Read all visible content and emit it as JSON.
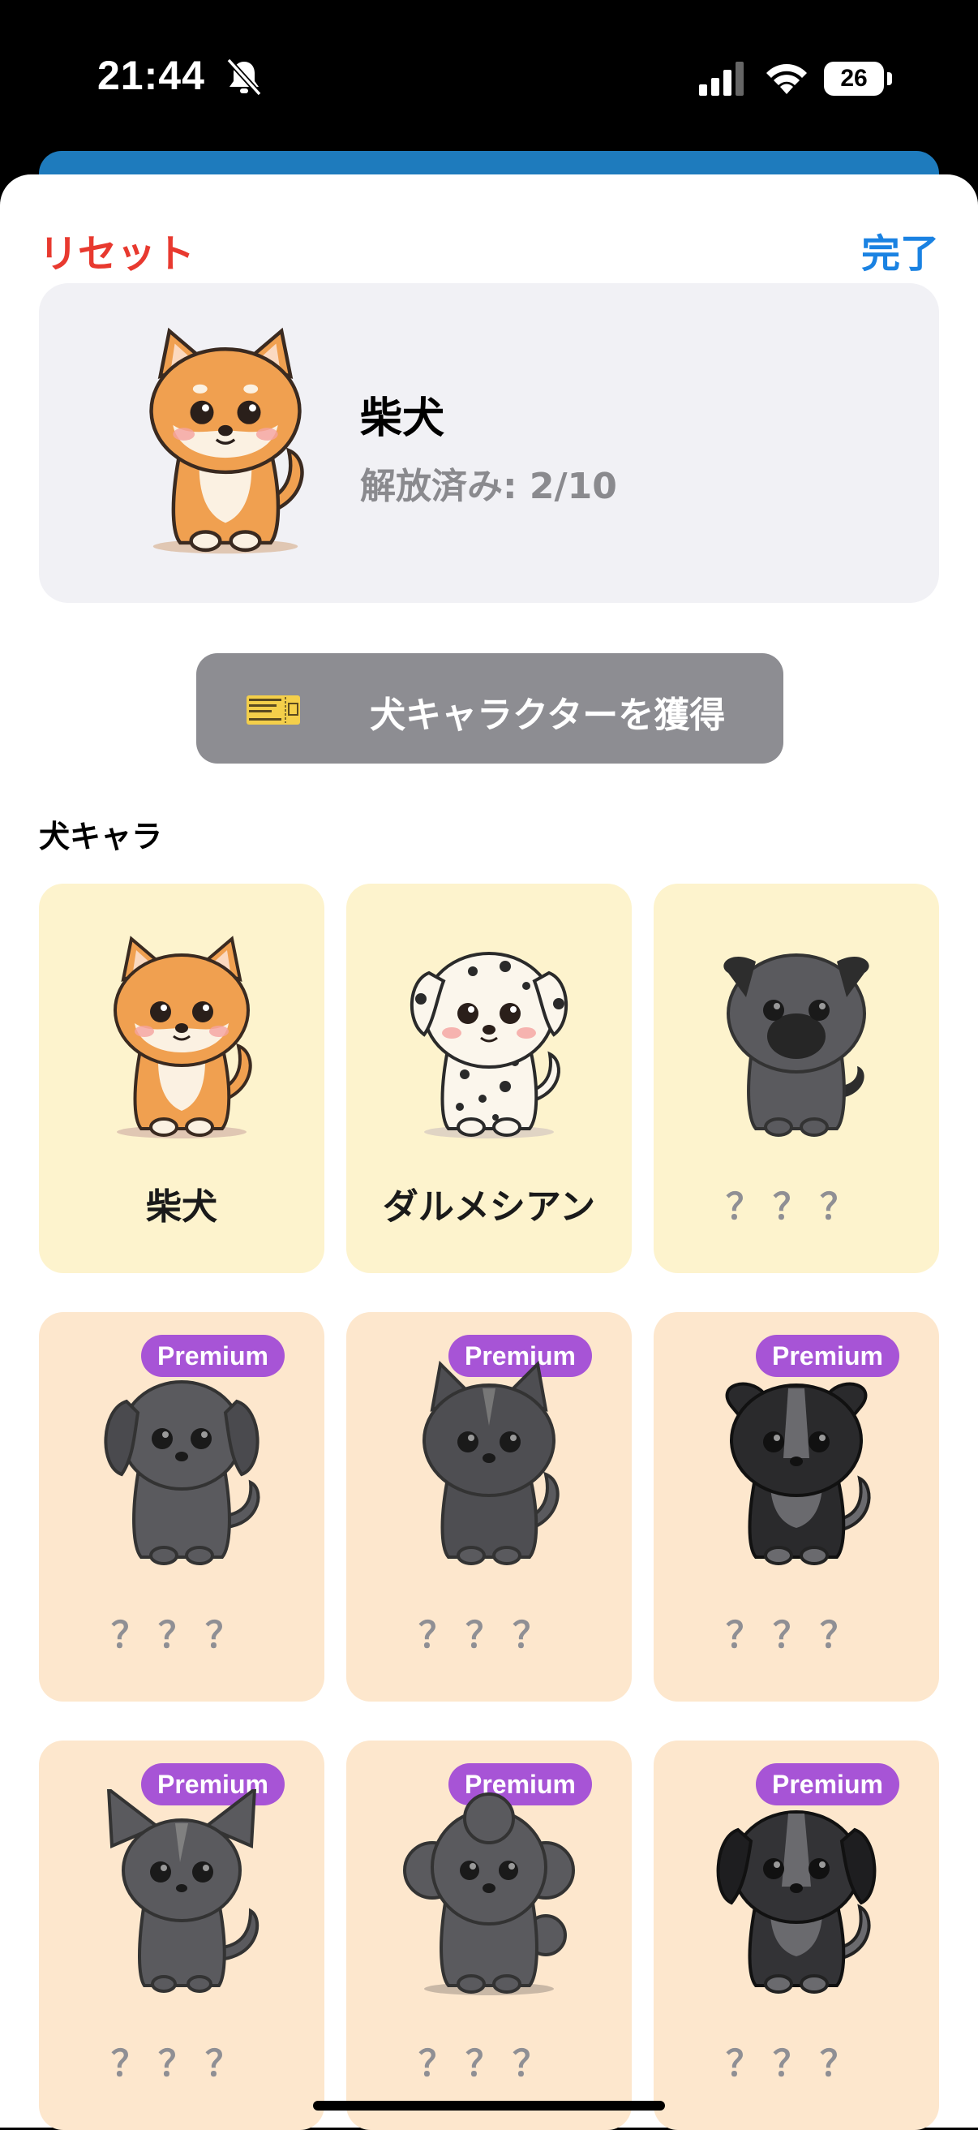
{
  "status_bar": {
    "time": "21:44",
    "battery": "26"
  },
  "header": {
    "reset_label": "リセット",
    "done_label": "完了"
  },
  "current": {
    "name": "柴犬",
    "unlocked": "解放済み: 2/10"
  },
  "acquire_button": {
    "label": "犬キャラクターを獲得",
    "ticket_icon": "ticket-icon"
  },
  "section": {
    "title": "犬キャラ"
  },
  "premium_badge": "Premium",
  "characters": [
    {
      "name": "柴犬",
      "locked": false,
      "premium": false,
      "icon": "shiba-icon"
    },
    {
      "name": "ダルメシアン",
      "locked": false,
      "premium": false,
      "icon": "dalmatian-icon"
    },
    {
      "name": "？？？",
      "locked": true,
      "premium": false,
      "icon": "pug-silhouette-icon"
    },
    {
      "name": "？？？",
      "locked": true,
      "premium": true,
      "icon": "retriever-silhouette-icon"
    },
    {
      "name": "？？？",
      "locked": true,
      "premium": true,
      "icon": "husky-silhouette-icon"
    },
    {
      "name": "？？？",
      "locked": true,
      "premium": true,
      "icon": "collie-silhouette-icon"
    },
    {
      "name": "？？？",
      "locked": true,
      "premium": true,
      "icon": "chihuahua-silhouette-icon"
    },
    {
      "name": "？？？",
      "locked": true,
      "premium": true,
      "icon": "poodle-silhouette-icon"
    },
    {
      "name": "？？？",
      "locked": true,
      "premium": true,
      "icon": "beagle-silhouette-icon"
    }
  ],
  "colors": {
    "accent_blue": "#1a82e2",
    "reset_red": "#e8392f",
    "premium_purple": "#a754d6",
    "free_card": "#fdf3cd",
    "premium_card": "#fde7cd"
  }
}
